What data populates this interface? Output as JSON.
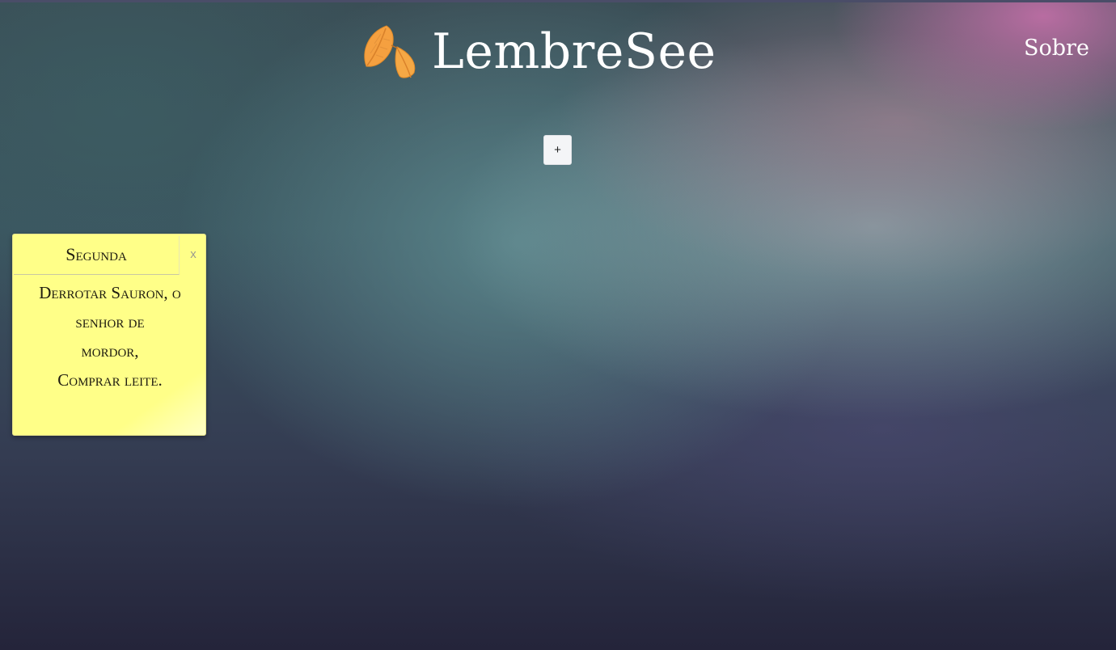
{
  "header": {
    "brand": "LembreSee",
    "logo_icon": "leaves-icon",
    "nav": {
      "about_label": "Sobre"
    }
  },
  "toolbar": {
    "add_label": "+"
  },
  "notes": [
    {
      "title": "Segunda",
      "close_label": "x",
      "lines": [
        "Derrotar Sauron, o senhor de",
        "mordor,",
        "Comprar leite."
      ],
      "color": "#ffff88"
    }
  ],
  "colors": {
    "note_background": "#ffff88",
    "logo_orange": "#f5a040"
  }
}
